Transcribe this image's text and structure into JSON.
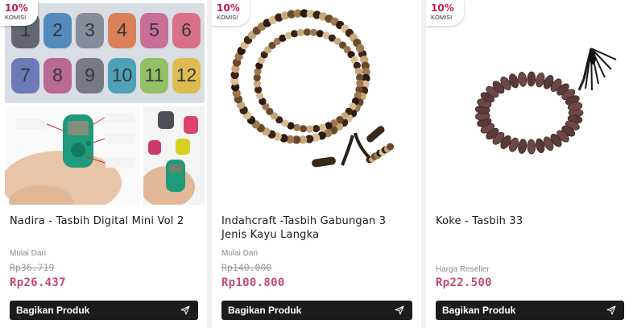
{
  "products": [
    {
      "badge_percent": "10%",
      "badge_label": "KOMISI",
      "title": "Nadira - Tasbih Digital Mini Vol 2",
      "price_label": "Mulai Dari",
      "original_price": "Rp36.719",
      "price": "Rp26.437",
      "share_label": "Bagikan Produk",
      "image_icon": "digital-counter-icon",
      "counter_numbers": [
        "1",
        "2",
        "3",
        "4",
        "5",
        "6",
        "7",
        "8",
        "9",
        "10",
        "11",
        "12"
      ],
      "counter_colors": [
        "#3a3f4a",
        "#2a6fb0",
        "#6b7280",
        "#d9622b",
        "#c44a7a",
        "#d94b6a",
        "#4a5aa8",
        "#b0427a",
        "#555a66",
        "#1f8fa8",
        "#7ab83a",
        "#e0b020"
      ]
    },
    {
      "badge_percent": "10%",
      "badge_label": "KOMISI",
      "title": "Indahcraft -Tasbih Gabungan 3 Jenis Kayu Langka",
      "price_label": "Mulai Dari",
      "original_price": "Rp140.000",
      "price": "Rp100.800",
      "share_label": "Bagikan Produk",
      "image_icon": "wooden-prayer-beads-icon"
    },
    {
      "badge_percent": "10%",
      "badge_label": "KOMISI",
      "title": "Koke - Tasbih 33",
      "price_label": "Harga Reseller",
      "price": "Rp22.500",
      "share_label": "Bagikan Produk",
      "image_icon": "prayer-beads-tassel-icon"
    }
  ],
  "colors": {
    "price": "#c04a7c",
    "badge": "#c2185b",
    "button": "#1c1c1c"
  }
}
